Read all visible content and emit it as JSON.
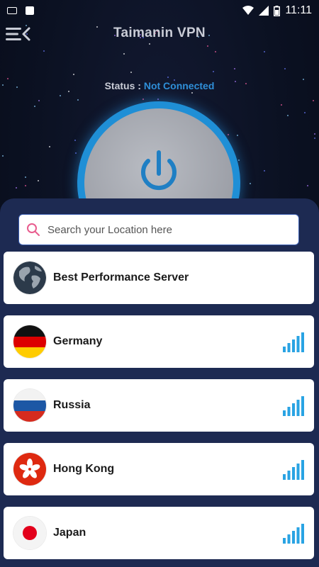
{
  "statusbar": {
    "time": "11:11",
    "icons": [
      "notification-icon",
      "app-icon",
      "wifi-icon",
      "signal-icon",
      "battery-icon"
    ]
  },
  "header": {
    "title": "Taimanin VPN",
    "menu_icon": "menu-arrow-icon"
  },
  "connection": {
    "status_label": "Status :",
    "status_value": "Not Connected",
    "status_color": "#2f8fd8",
    "power_icon": "power-icon"
  },
  "search": {
    "placeholder": "Search your Location here",
    "value": "",
    "icon": "search-icon"
  },
  "servers": [
    {
      "name": "Best Performance Server",
      "icon": "globe-icon",
      "signal": null
    },
    {
      "name": "Germany",
      "icon": "germany-flag-icon",
      "signal": "signal-strength-icon"
    },
    {
      "name": "Russia",
      "icon": "russia-flag-icon",
      "signal": "signal-strength-icon"
    },
    {
      "name": "Hong Kong",
      "icon": "hong-kong-flag-icon",
      "signal": "signal-strength-icon"
    },
    {
      "name": "Japan",
      "icon": "japan-flag-icon",
      "signal": "signal-strength-icon"
    }
  ],
  "colors": {
    "accent": "#1f8fd6",
    "sheet": "#1d2a52",
    "signal": "#29a3e3"
  }
}
